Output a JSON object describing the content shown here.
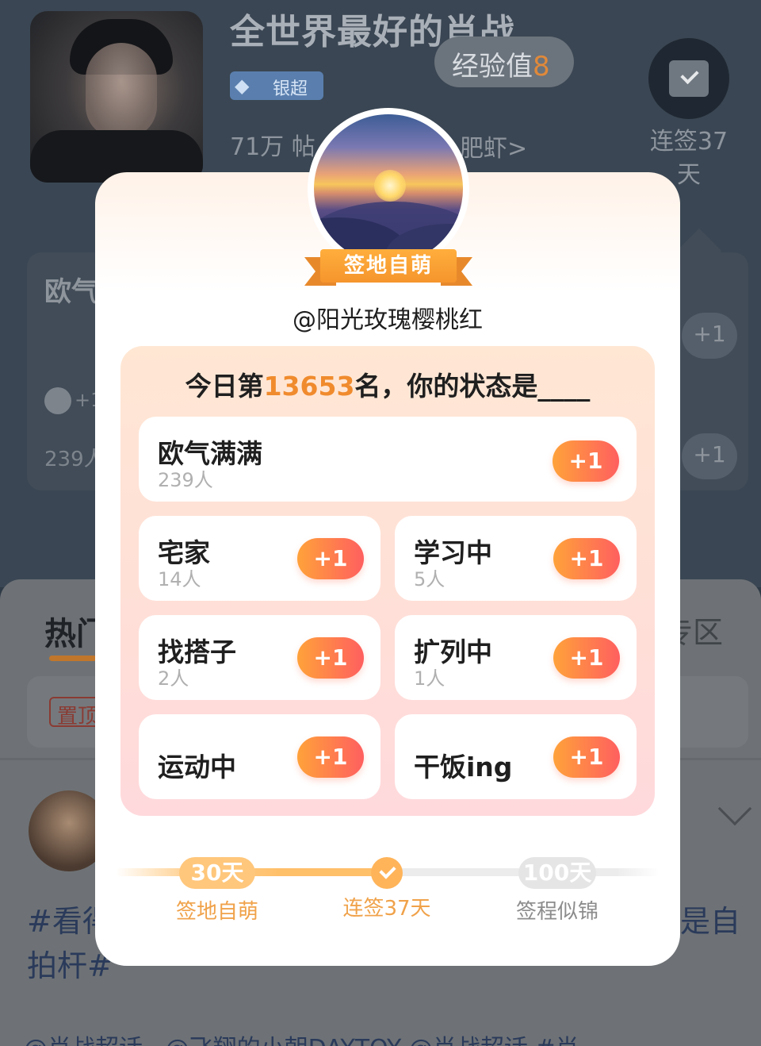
{
  "header": {
    "title": "全世界最好的肖战",
    "badge": "银超",
    "stats": "71万 帖",
    "shrimp": "肥虾>",
    "exp_label": "经验值",
    "exp_value": "8",
    "streak_line1": "连签37",
    "streak_line2": "天"
  },
  "background_card": {
    "title": "欧气",
    "plus": "+1",
    "count": "239人",
    "btn1": "+1",
    "btn2": "+1"
  },
  "background_tabs": {
    "hot": "热门",
    "zone": "专区"
  },
  "background_post": {
    "pinned": "置顶",
    "line1": "#看得",
    "line1_right": "是自",
    "line2": "拍杆#",
    "bottom": "@肖战超话 · @飞翔的小朝DAYTOY @肖战超话 #肖"
  },
  "modal": {
    "level_ribbon": "签地自萌",
    "username": "@阳光玫瑰樱桃红",
    "question_prefix": "今日第",
    "rank": "13653",
    "question_suffix": "名，你的状态是____",
    "options": [
      {
        "name": "欧气满满",
        "count": "239人",
        "button": "+1"
      },
      {
        "name": "宅家",
        "count": "14人",
        "button": "+1"
      },
      {
        "name": "学习中",
        "count": "5人",
        "button": "+1"
      },
      {
        "name": "找搭子",
        "count": "2人",
        "button": "+1"
      },
      {
        "name": "扩列中",
        "count": "1人",
        "button": "+1"
      },
      {
        "name": "运动中",
        "count": "",
        "button": "+1"
      },
      {
        "name": "干饭ing",
        "count": "",
        "button": "+1"
      }
    ],
    "progress": {
      "milestone1_days": "30天",
      "milestone1_label": "签地自萌",
      "current_label": "连签37天",
      "milestone2_days": "100天",
      "milestone2_label": "签程似锦",
      "streak_days": 37
    }
  },
  "colors": {
    "accent_orange": "#f08b2d",
    "button_gradient_start": "#ffa23a",
    "button_gradient_end": "#ff5f5f",
    "panel_pink": "#ffe0d7"
  }
}
